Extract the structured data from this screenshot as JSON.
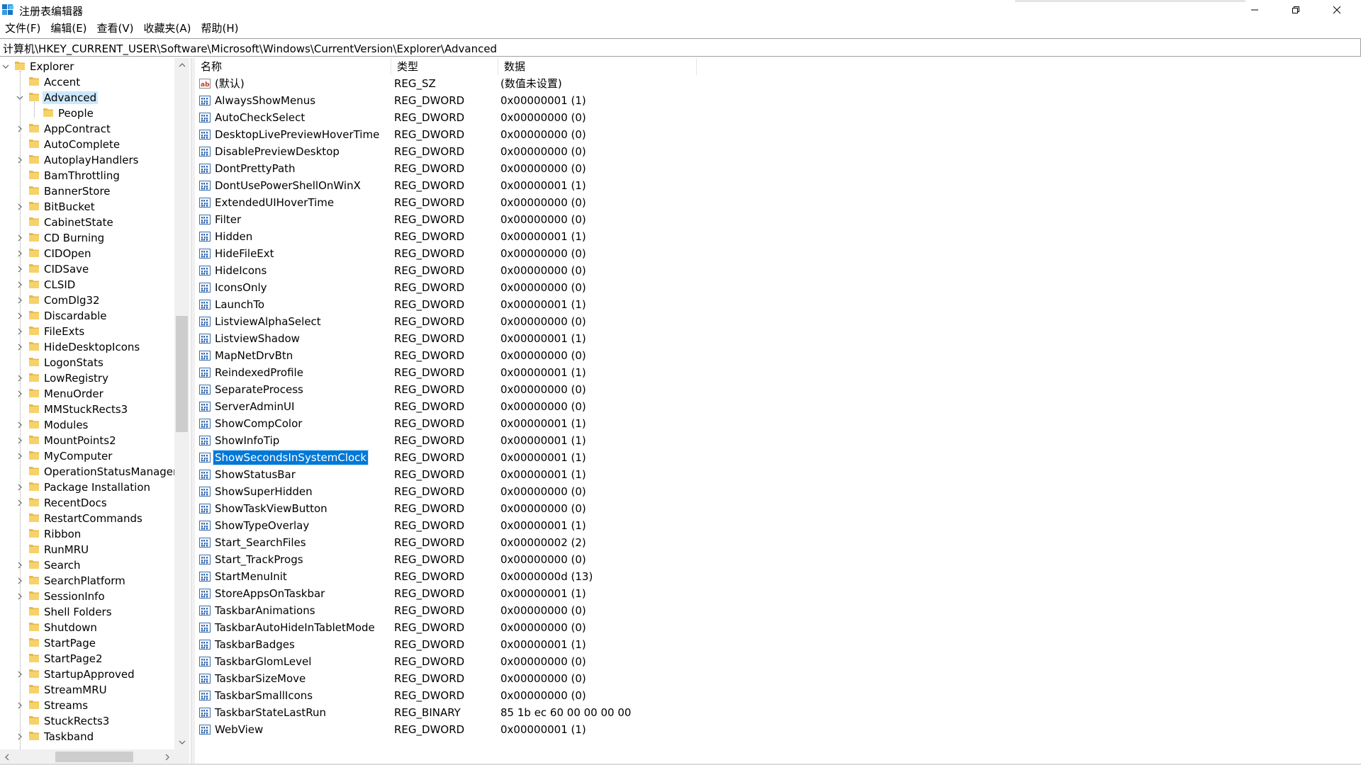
{
  "window": {
    "title": "注册表编辑器",
    "icon": "regedit-icon"
  },
  "menu": [
    "文件(F)",
    "编辑(E)",
    "查看(V)",
    "收藏夹(A)",
    "帮助(H)"
  ],
  "address": "计算机\\HKEY_CURRENT_USER\\Software\\Microsoft\\Windows\\CurrentVersion\\Explorer\\Advanced",
  "tree": [
    {
      "label": "Explorer",
      "depth": 0,
      "expander": "expanded"
    },
    {
      "label": "Accent",
      "depth": 1,
      "expander": "none"
    },
    {
      "label": "Advanced",
      "depth": 1,
      "expander": "expanded",
      "selected": true
    },
    {
      "label": "People",
      "depth": 2,
      "expander": "none"
    },
    {
      "label": "AppContract",
      "depth": 1,
      "expander": "collapsed"
    },
    {
      "label": "AutoComplete",
      "depth": 1,
      "expander": "none"
    },
    {
      "label": "AutoplayHandlers",
      "depth": 1,
      "expander": "collapsed"
    },
    {
      "label": "BamThrottling",
      "depth": 1,
      "expander": "none"
    },
    {
      "label": "BannerStore",
      "depth": 1,
      "expander": "none"
    },
    {
      "label": "BitBucket",
      "depth": 1,
      "expander": "collapsed"
    },
    {
      "label": "CabinetState",
      "depth": 1,
      "expander": "none"
    },
    {
      "label": "CD Burning",
      "depth": 1,
      "expander": "collapsed"
    },
    {
      "label": "CIDOpen",
      "depth": 1,
      "expander": "collapsed"
    },
    {
      "label": "CIDSave",
      "depth": 1,
      "expander": "collapsed"
    },
    {
      "label": "CLSID",
      "depth": 1,
      "expander": "collapsed"
    },
    {
      "label": "ComDlg32",
      "depth": 1,
      "expander": "collapsed"
    },
    {
      "label": "Discardable",
      "depth": 1,
      "expander": "collapsed"
    },
    {
      "label": "FileExts",
      "depth": 1,
      "expander": "collapsed"
    },
    {
      "label": "HideDesktopIcons",
      "depth": 1,
      "expander": "collapsed"
    },
    {
      "label": "LogonStats",
      "depth": 1,
      "expander": "none"
    },
    {
      "label": "LowRegistry",
      "depth": 1,
      "expander": "collapsed"
    },
    {
      "label": "MenuOrder",
      "depth": 1,
      "expander": "collapsed"
    },
    {
      "label": "MMStuckRects3",
      "depth": 1,
      "expander": "none"
    },
    {
      "label": "Modules",
      "depth": 1,
      "expander": "collapsed"
    },
    {
      "label": "MountPoints2",
      "depth": 1,
      "expander": "collapsed"
    },
    {
      "label": "MyComputer",
      "depth": 1,
      "expander": "collapsed"
    },
    {
      "label": "OperationStatusManager",
      "depth": 1,
      "expander": "none"
    },
    {
      "label": "Package Installation",
      "depth": 1,
      "expander": "collapsed"
    },
    {
      "label": "RecentDocs",
      "depth": 1,
      "expander": "collapsed"
    },
    {
      "label": "RestartCommands",
      "depth": 1,
      "expander": "none"
    },
    {
      "label": "Ribbon",
      "depth": 1,
      "expander": "none"
    },
    {
      "label": "RunMRU",
      "depth": 1,
      "expander": "none"
    },
    {
      "label": "Search",
      "depth": 1,
      "expander": "collapsed"
    },
    {
      "label": "SearchPlatform",
      "depth": 1,
      "expander": "collapsed"
    },
    {
      "label": "SessionInfo",
      "depth": 1,
      "expander": "collapsed"
    },
    {
      "label": "Shell Folders",
      "depth": 1,
      "expander": "none"
    },
    {
      "label": "Shutdown",
      "depth": 1,
      "expander": "none"
    },
    {
      "label": "StartPage",
      "depth": 1,
      "expander": "none"
    },
    {
      "label": "StartPage2",
      "depth": 1,
      "expander": "none"
    },
    {
      "label": "StartupApproved",
      "depth": 1,
      "expander": "collapsed"
    },
    {
      "label": "StreamMRU",
      "depth": 1,
      "expander": "none"
    },
    {
      "label": "Streams",
      "depth": 1,
      "expander": "collapsed"
    },
    {
      "label": "StuckRects3",
      "depth": 1,
      "expander": "none"
    },
    {
      "label": "Taskband",
      "depth": 1,
      "expander": "collapsed"
    }
  ],
  "columns": {
    "name": "名称",
    "type": "类型",
    "data": "数据"
  },
  "values": [
    {
      "name": "(默认)",
      "type": "REG_SZ",
      "data": "(数值未设置)",
      "icon": "string-value-icon"
    },
    {
      "name": "AlwaysShowMenus",
      "type": "REG_DWORD",
      "data": "0x00000001 (1)",
      "icon": "binary-value-icon"
    },
    {
      "name": "AutoCheckSelect",
      "type": "REG_DWORD",
      "data": "0x00000000 (0)",
      "icon": "binary-value-icon"
    },
    {
      "name": "DesktopLivePreviewHoverTime",
      "type": "REG_DWORD",
      "data": "0x00000000 (0)",
      "icon": "binary-value-icon"
    },
    {
      "name": "DisablePreviewDesktop",
      "type": "REG_DWORD",
      "data": "0x00000000 (0)",
      "icon": "binary-value-icon"
    },
    {
      "name": "DontPrettyPath",
      "type": "REG_DWORD",
      "data": "0x00000000 (0)",
      "icon": "binary-value-icon"
    },
    {
      "name": "DontUsePowerShellOnWinX",
      "type": "REG_DWORD",
      "data": "0x00000001 (1)",
      "icon": "binary-value-icon"
    },
    {
      "name": "ExtendedUIHoverTime",
      "type": "REG_DWORD",
      "data": "0x00000000 (0)",
      "icon": "binary-value-icon"
    },
    {
      "name": "Filter",
      "type": "REG_DWORD",
      "data": "0x00000000 (0)",
      "icon": "binary-value-icon"
    },
    {
      "name": "Hidden",
      "type": "REG_DWORD",
      "data": "0x00000001 (1)",
      "icon": "binary-value-icon"
    },
    {
      "name": "HideFileExt",
      "type": "REG_DWORD",
      "data": "0x00000000 (0)",
      "icon": "binary-value-icon"
    },
    {
      "name": "HideIcons",
      "type": "REG_DWORD",
      "data": "0x00000000 (0)",
      "icon": "binary-value-icon"
    },
    {
      "name": "IconsOnly",
      "type": "REG_DWORD",
      "data": "0x00000000 (0)",
      "icon": "binary-value-icon"
    },
    {
      "name": "LaunchTo",
      "type": "REG_DWORD",
      "data": "0x00000001 (1)",
      "icon": "binary-value-icon"
    },
    {
      "name": "ListviewAlphaSelect",
      "type": "REG_DWORD",
      "data": "0x00000000 (0)",
      "icon": "binary-value-icon"
    },
    {
      "name": "ListviewShadow",
      "type": "REG_DWORD",
      "data": "0x00000001 (1)",
      "icon": "binary-value-icon"
    },
    {
      "name": "MapNetDrvBtn",
      "type": "REG_DWORD",
      "data": "0x00000000 (0)",
      "icon": "binary-value-icon"
    },
    {
      "name": "ReindexedProfile",
      "type": "REG_DWORD",
      "data": "0x00000001 (1)",
      "icon": "binary-value-icon"
    },
    {
      "name": "SeparateProcess",
      "type": "REG_DWORD",
      "data": "0x00000000 (0)",
      "icon": "binary-value-icon"
    },
    {
      "name": "ServerAdminUI",
      "type": "REG_DWORD",
      "data": "0x00000000 (0)",
      "icon": "binary-value-icon"
    },
    {
      "name": "ShowCompColor",
      "type": "REG_DWORD",
      "data": "0x00000001 (1)",
      "icon": "binary-value-icon"
    },
    {
      "name": "ShowInfoTip",
      "type": "REG_DWORD",
      "data": "0x00000001 (1)",
      "icon": "binary-value-icon"
    },
    {
      "name": "ShowSecondsInSystemClock",
      "type": "REG_DWORD",
      "data": "0x00000001 (1)",
      "icon": "binary-value-icon",
      "selected": true
    },
    {
      "name": "ShowStatusBar",
      "type": "REG_DWORD",
      "data": "0x00000001 (1)",
      "icon": "binary-value-icon"
    },
    {
      "name": "ShowSuperHidden",
      "type": "REG_DWORD",
      "data": "0x00000000 (0)",
      "icon": "binary-value-icon"
    },
    {
      "name": "ShowTaskViewButton",
      "type": "REG_DWORD",
      "data": "0x00000000 (0)",
      "icon": "binary-value-icon"
    },
    {
      "name": "ShowTypeOverlay",
      "type": "REG_DWORD",
      "data": "0x00000001 (1)",
      "icon": "binary-value-icon"
    },
    {
      "name": "Start_SearchFiles",
      "type": "REG_DWORD",
      "data": "0x00000002 (2)",
      "icon": "binary-value-icon"
    },
    {
      "name": "Start_TrackProgs",
      "type": "REG_DWORD",
      "data": "0x00000000 (0)",
      "icon": "binary-value-icon"
    },
    {
      "name": "StartMenuInit",
      "type": "REG_DWORD",
      "data": "0x0000000d (13)",
      "icon": "binary-value-icon"
    },
    {
      "name": "StoreAppsOnTaskbar",
      "type": "REG_DWORD",
      "data": "0x00000001 (1)",
      "icon": "binary-value-icon"
    },
    {
      "name": "TaskbarAnimations",
      "type": "REG_DWORD",
      "data": "0x00000000 (0)",
      "icon": "binary-value-icon"
    },
    {
      "name": "TaskbarAutoHideInTabletMode",
      "type": "REG_DWORD",
      "data": "0x00000000 (0)",
      "icon": "binary-value-icon"
    },
    {
      "name": "TaskbarBadges",
      "type": "REG_DWORD",
      "data": "0x00000001 (1)",
      "icon": "binary-value-icon"
    },
    {
      "name": "TaskbarGlomLevel",
      "type": "REG_DWORD",
      "data": "0x00000000 (0)",
      "icon": "binary-value-icon"
    },
    {
      "name": "TaskbarSizeMove",
      "type": "REG_DWORD",
      "data": "0x00000000 (0)",
      "icon": "binary-value-icon"
    },
    {
      "name": "TaskbarSmallIcons",
      "type": "REG_DWORD",
      "data": "0x00000000 (0)",
      "icon": "binary-value-icon"
    },
    {
      "name": "TaskbarStateLastRun",
      "type": "REG_BINARY",
      "data": "85 1b ec 60 00 00 00 00",
      "icon": "binary-value-icon"
    },
    {
      "name": "WebView",
      "type": "REG_DWORD",
      "data": "0x00000001 (1)",
      "icon": "binary-value-icon"
    }
  ],
  "colors": {
    "selection_bg": "#0078d7",
    "tree_selection_bg": "#cce8ff",
    "folder": "#e8b84a"
  }
}
